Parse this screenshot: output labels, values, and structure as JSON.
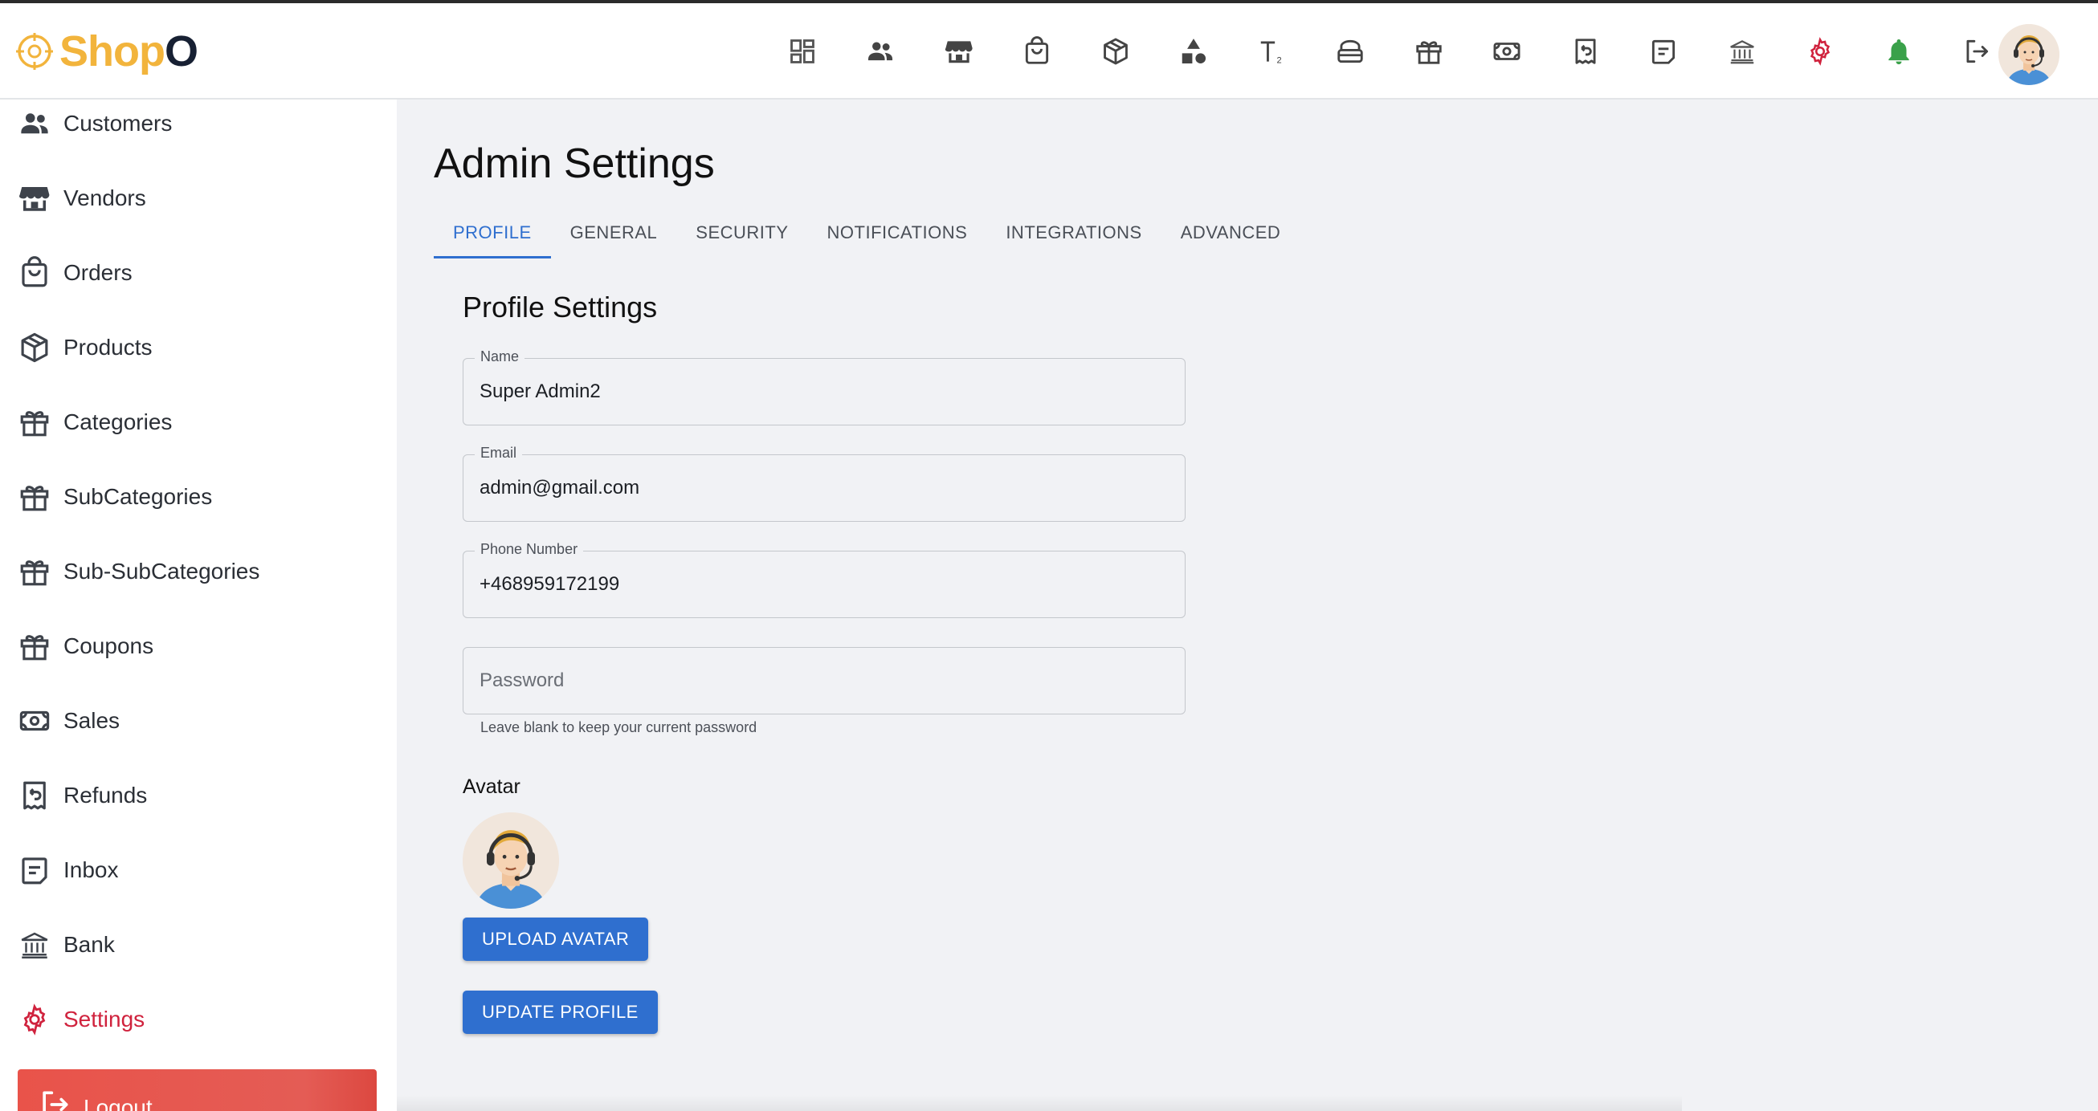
{
  "header": {
    "logo_part1": "Shop",
    "logo_part2": "O",
    "brand_gold": "#f2b43c",
    "brand_dark": "#172033",
    "icons": [
      "dashboard-icon",
      "customers-icon",
      "vendors-icon",
      "orders-icon",
      "products-icon",
      "categories-icon",
      "subcategories-icon",
      "sub-subcategories-icon",
      "coupons-icon",
      "sales-icon",
      "refunds-icon",
      "inbox-icon",
      "bank-icon",
      "settings-icon",
      "notifications-bell-icon",
      "logout-icon"
    ]
  },
  "sidebar": {
    "items": [
      {
        "label": "Customers",
        "icon": "customers-icon"
      },
      {
        "label": "Vendors",
        "icon": "vendors-icon"
      },
      {
        "label": "Orders",
        "icon": "orders-icon"
      },
      {
        "label": "Products",
        "icon": "products-icon"
      },
      {
        "label": "Categories",
        "icon": "categories-icon"
      },
      {
        "label": "SubCategories",
        "icon": "subcategories-icon"
      },
      {
        "label": "Sub-SubCategories",
        "icon": "sub-subcategories-icon"
      },
      {
        "label": "Coupons",
        "icon": "coupons-icon"
      },
      {
        "label": "Sales",
        "icon": "sales-icon"
      },
      {
        "label": "Refunds",
        "icon": "refunds-icon"
      },
      {
        "label": "Inbox",
        "icon": "inbox-icon"
      },
      {
        "label": "Bank",
        "icon": "bank-icon"
      },
      {
        "label": "Settings",
        "icon": "settings-icon"
      }
    ],
    "active_item": "Settings",
    "logout_label": "Logout",
    "active_color": "#d0223d"
  },
  "main": {
    "title": "Admin Settings",
    "tabs": [
      "PROFILE",
      "GENERAL",
      "SECURITY",
      "NOTIFICATIONS",
      "INTEGRATIONS",
      "ADVANCED"
    ],
    "active_tab": "PROFILE",
    "section_title": "Profile Settings",
    "fields": {
      "name": {
        "label": "Name",
        "value": "Super Admin2"
      },
      "email": {
        "label": "Email",
        "value": "admin@gmail.com"
      },
      "phone": {
        "label": "Phone Number",
        "value": "+468959172199"
      },
      "password": {
        "placeholder": "Password",
        "value": ""
      }
    },
    "password_helper": "Leave blank to keep your current password",
    "avatar_label": "Avatar",
    "upload_button": "UPLOAD AVATAR",
    "update_button": "UPDATE PROFILE",
    "accent_color": "#2f6fcf"
  }
}
